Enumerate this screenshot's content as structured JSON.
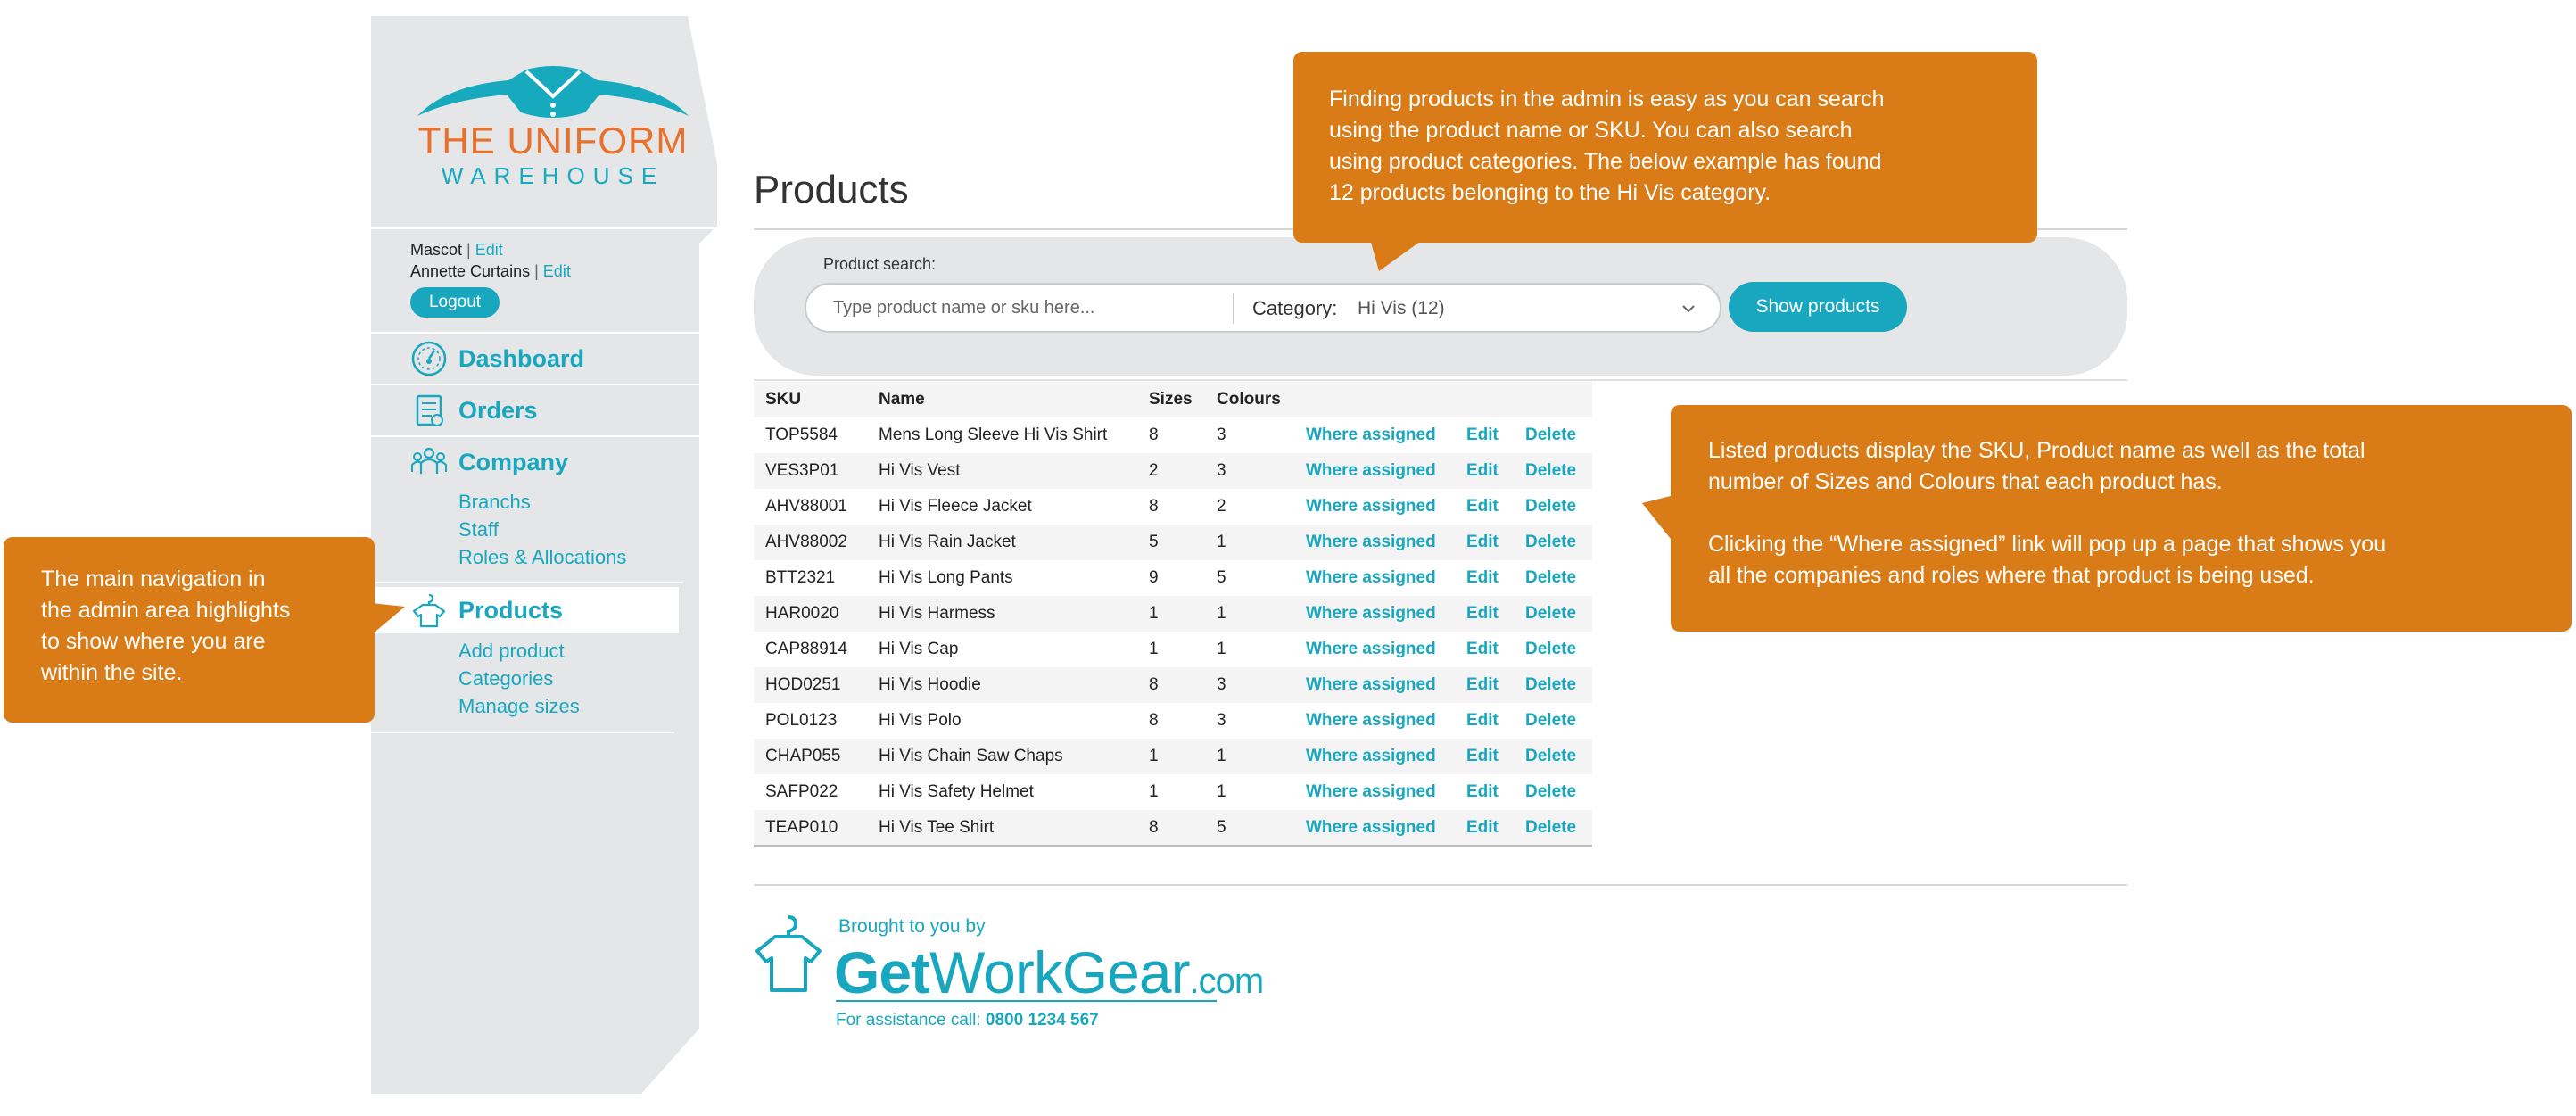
{
  "brand": {
    "name_line1": "THE UNIFORM",
    "name_line2": "WAREHOUSE",
    "colors": {
      "teal": "#18a7bf",
      "orange": "#e8702a",
      "callout": "#d97b16",
      "sidebar": "#e4e6e7"
    }
  },
  "user": {
    "company": "Mascot",
    "person": "Annette Curtains",
    "edit_label": "Edit",
    "separator": "|",
    "logout_label": "Logout"
  },
  "nav": {
    "dashboard": {
      "label": "Dashboard",
      "icon": "gauge-icon"
    },
    "orders": {
      "label": "Orders",
      "icon": "order-list-icon"
    },
    "company": {
      "label": "Company",
      "icon": "people-icon",
      "sub": [
        "Branchs",
        "Staff",
        "Roles & Allocations"
      ]
    },
    "products": {
      "label": "Products",
      "icon": "shirt-hanger-icon",
      "active": true,
      "sub": [
        "Add product",
        "Categories",
        "Manage sizes"
      ]
    }
  },
  "page": {
    "title": "Products"
  },
  "search": {
    "label": "Product search:",
    "placeholder": "Type product name or sku here...",
    "category_label": "Category:",
    "category_value": "Hi Vis (12)",
    "button_label": "Show products"
  },
  "table": {
    "headers": [
      "SKU",
      "Name",
      "Sizes",
      "Colours"
    ],
    "actions": [
      "Where assigned",
      "Edit",
      "Delete"
    ],
    "rows": [
      [
        "TOP5584",
        "Mens Long Sleeve Hi Vis Shirt",
        "8",
        "3"
      ],
      [
        "VES3P01",
        "Hi Vis Vest",
        "2",
        "3"
      ],
      [
        "AHV88001",
        "Hi Vis Fleece Jacket",
        "8",
        "2"
      ],
      [
        "AHV88002",
        "Hi Vis Rain Jacket",
        "5",
        "1"
      ],
      [
        "BTT2321",
        "Hi Vis Long Pants",
        "9",
        "5"
      ],
      [
        "HAR0020",
        "Hi Vis Harmess",
        "1",
        "1"
      ],
      [
        "CAP88914",
        "Hi Vis Cap",
        "1",
        "1"
      ],
      [
        "HOD0251",
        "Hi Vis Hoodie",
        "8",
        "3"
      ],
      [
        "POL0123",
        "Hi Vis Polo",
        "8",
        "3"
      ],
      [
        "CHAP055",
        "Hi Vis Chain Saw Chaps",
        "1",
        "1"
      ],
      [
        "SAFP022",
        "Hi Vis Safety Helmet",
        "1",
        "1"
      ],
      [
        "TEAP010",
        "Hi Vis Tee Shirt",
        "8",
        "5"
      ]
    ]
  },
  "callouts": {
    "search": [
      "Finding products in the admin is easy as you can search",
      "using the product name or SKU. You can also search",
      "using product categories. The below example has found",
      "12 products belonging to the Hi Vis category."
    ],
    "table": [
      "Listed products display the SKU, Product name as well as the total",
      "number of Sizes and Colours that each product has.",
      "",
      "Clicking the “Where assigned” link will pop up a page that shows you",
      "all the companies and roles where that product is being used."
    ],
    "nav": [
      "The main navigation in",
      "the admin area highlights",
      "to show where you are",
      "within the site."
    ]
  },
  "footer": {
    "brought": "Brought to you by",
    "logo_bold": "Get",
    "logo_light": "WorkGear",
    "logo_suffix": ".com",
    "assist_label": "For assistance call:",
    "assist_phone": "0800 1234 567"
  }
}
